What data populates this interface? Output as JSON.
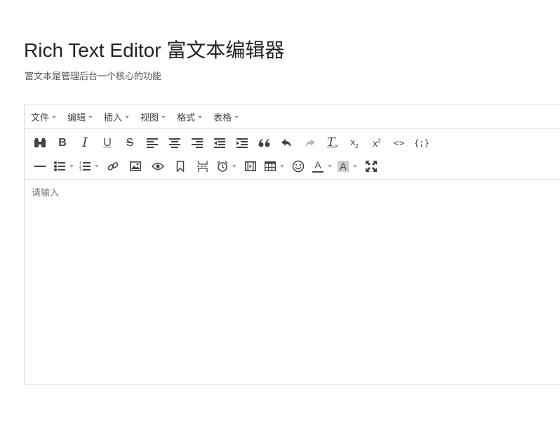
{
  "header": {
    "title": "Rich Text Editor  富文本编辑器",
    "subtitle": "富文本是管理后台一个核心的功能"
  },
  "menubar": {
    "items": [
      {
        "label": "文件"
      },
      {
        "label": "编辑"
      },
      {
        "label": "插入"
      },
      {
        "label": "视图"
      },
      {
        "label": "格式"
      },
      {
        "label": "表格"
      }
    ]
  },
  "toolbar": {
    "row1": [
      "search-replace-icon",
      "bold-icon",
      "italic-icon",
      "underline-icon",
      "strikethrough-icon",
      "align-left-icon",
      "align-center-icon",
      "align-right-icon",
      "outdent-icon",
      "indent-icon",
      "blockquote-icon",
      "undo-icon",
      "redo-icon",
      "remove-format-icon",
      "subscript-icon",
      "superscript-icon",
      "code-icon",
      "code-sample-icon"
    ],
    "row2": [
      "horizontal-rule-icon",
      "bullet-list-icon",
      "numbered-list-icon",
      "link-icon",
      "image-icon",
      "preview-icon",
      "bookmark-icon",
      "page-break-icon",
      "insert-datetime-icon",
      "media-icon",
      "table-icon",
      "emoticons-icon",
      "text-color-icon",
      "background-color-icon",
      "fullscreen-icon"
    ]
  },
  "editor": {
    "placeholder": "请输入",
    "text_color_letter": "A",
    "background_color_letter": "A",
    "bold_letter": "B",
    "italic_letter": "I",
    "underline_letter": "U",
    "strike_letter": "S",
    "clear_letter": "T",
    "sub_letter": "x",
    "sup_letter": "x",
    "code_sample_text": "{;}",
    "code_text": "<>"
  },
  "colors": {
    "border": "#d9d9d9",
    "icon": "#444444",
    "text_color_bar": "#444444",
    "bg_color_swatch": "#cccccc"
  }
}
